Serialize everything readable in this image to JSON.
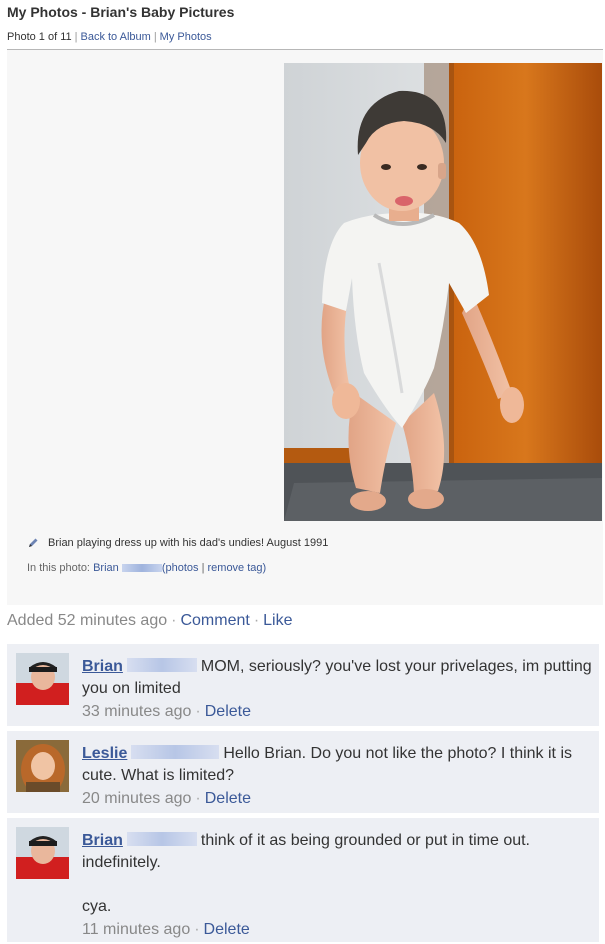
{
  "header": {
    "title": "My Photos - Brian's Baby Pictures",
    "photo_position": "Photo 1 of 11",
    "back_link": "Back to Album",
    "my_photos_link": "My Photos"
  },
  "photo": {
    "caption": "Brian playing dress up with his dad's undies! August 1991",
    "tag_prefix": "In this photo:",
    "tag_name": "Brian",
    "tag_photos_link": "(photos",
    "tag_separator": "|",
    "tag_remove_link": "remove tag)"
  },
  "meta": {
    "added": "Added 52 minutes ago",
    "comment_link": "Comment",
    "like_link": "Like"
  },
  "comments": [
    {
      "author": "Brian",
      "text": "MOM, seriously? you've lost your privelages, im putting you on limited",
      "time": "33 minutes ago",
      "delete": "Delete"
    },
    {
      "author": "Leslie",
      "text": "Hello Brian. Do you not like the photo? I think it is cute. What is limited?",
      "time": "20 minutes ago",
      "delete": "Delete"
    },
    {
      "author": "Brian",
      "text": "think of it as being grounded or put in time out. indefinitely.",
      "text2": "cya.",
      "time": "11 minutes ago",
      "delete": "Delete"
    }
  ],
  "colors": {
    "link": "#3b5998",
    "comment_bg": "#edeff4",
    "photo_panel_bg": "#f7f7f7"
  },
  "icons": [
    "pencil-icon"
  ]
}
